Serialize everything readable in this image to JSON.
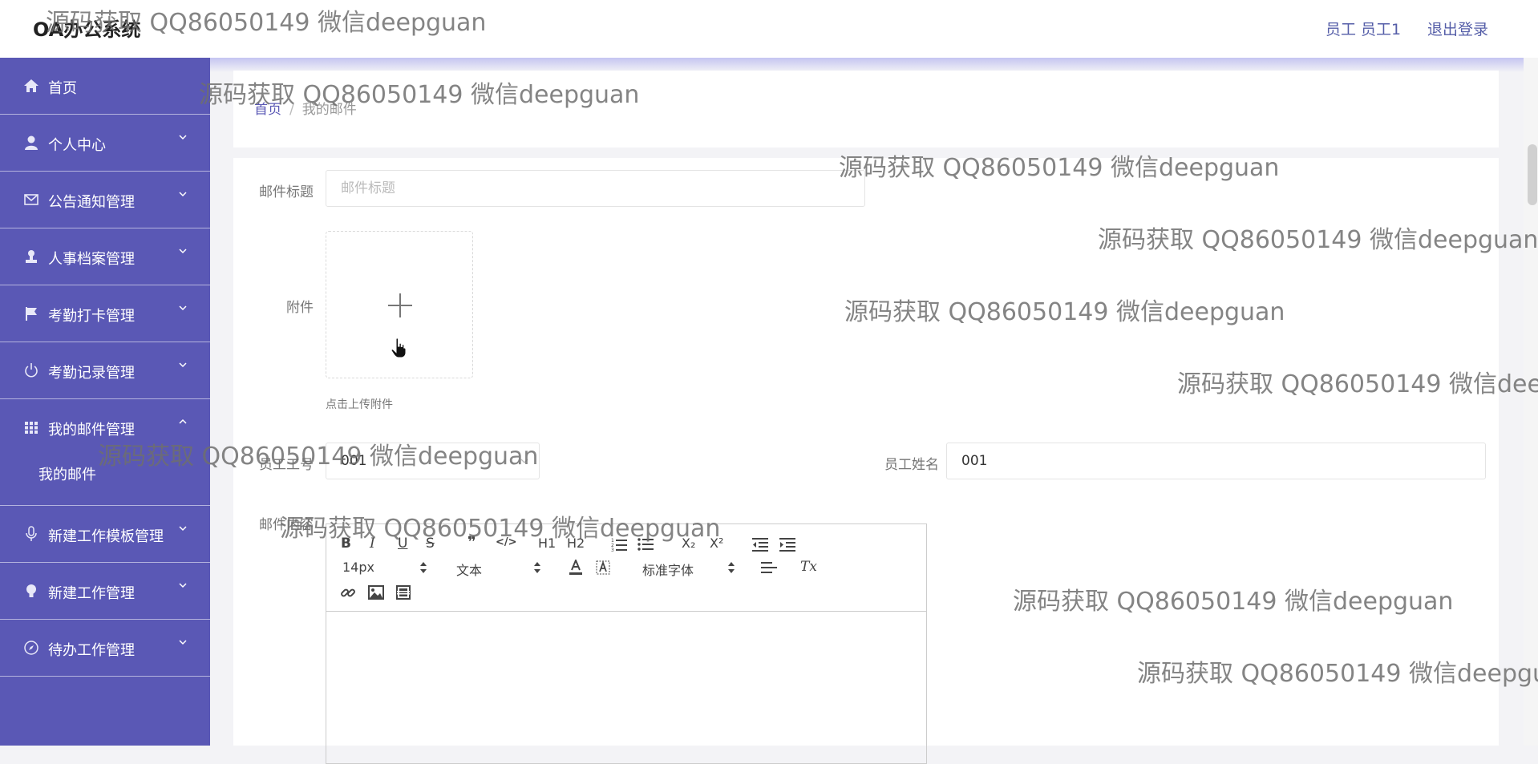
{
  "app": {
    "title": "OA办公系统"
  },
  "header": {
    "user_label": "员工 员工1",
    "logout_label": "退出登录"
  },
  "sidebar": {
    "items": [
      {
        "label": "首页",
        "icon": "home-icon"
      },
      {
        "label": "个人中心",
        "icon": "user-icon"
      },
      {
        "label": "公告通知管理",
        "icon": "mail-icon"
      },
      {
        "label": "人事档案管理",
        "icon": "stamp-icon"
      },
      {
        "label": "考勤打卡管理",
        "icon": "flag-icon"
      },
      {
        "label": "考勤记录管理",
        "icon": "power-icon"
      },
      {
        "label": "我的邮件管理",
        "icon": "grid-icon",
        "expanded": true,
        "subitems": [
          {
            "label": "我的邮件"
          }
        ]
      },
      {
        "label": "新建工作模板管理",
        "icon": "microphone-icon"
      },
      {
        "label": "新建工作管理",
        "icon": "bulb-icon"
      },
      {
        "label": "待办工作管理",
        "icon": "compass-icon"
      }
    ]
  },
  "breadcrumb": {
    "home": "首页",
    "separator": "/",
    "current": "我的邮件"
  },
  "form": {
    "title": {
      "label": "邮件标题",
      "placeholder": "邮件标题",
      "value": ""
    },
    "attachment": {
      "label": "附件",
      "tip": "点击上传附件"
    },
    "employee_id": {
      "label": "员工工号",
      "value": "001"
    },
    "employee_name": {
      "label": "员工姓名",
      "value": "001"
    },
    "content": {
      "label": "邮件内容"
    }
  },
  "editor": {
    "font_size": "14px",
    "text_style": "文本",
    "font_family": "标准字体",
    "buttons": {
      "bold": "B",
      "italic": "I",
      "underline": "U",
      "strike": "S",
      "quote": "❞",
      "code": "</>",
      "h1": "H1",
      "h2": "H2",
      "subscript": "X₂",
      "superscript": "X²",
      "clear_format": "Tx"
    }
  },
  "watermark": {
    "text": "源码获取 QQ86050149 微信deepguan"
  },
  "colors": {
    "sidebar_bg": "#5a58b5",
    "accent": "#5a58b5",
    "page_bg": "#f3f3f6"
  }
}
